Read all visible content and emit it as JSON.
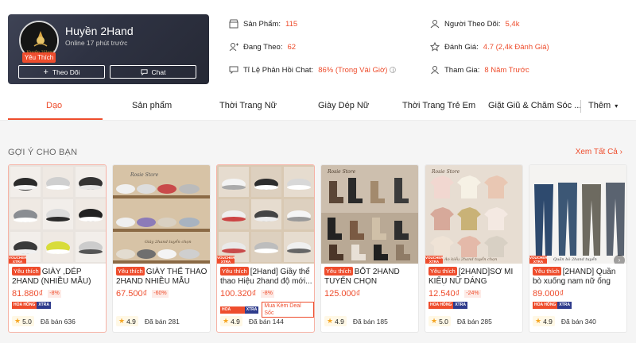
{
  "shop": {
    "name": "Huyền 2Hand",
    "online": "Online 17 phút trước",
    "badge": "Yêu Thích",
    "follow_label": "Theo Dõi",
    "chat_label": "Chat"
  },
  "stats": {
    "products_label": "Sản Phẩm:",
    "products_value": "115",
    "following_label": "Đang Theo:",
    "following_value": "62",
    "response_label": "Tỉ Lệ Phản Hồi Chat:",
    "response_value": "86% (Trong Vài Giờ)",
    "followers_label": "Người Theo Dõi:",
    "followers_value": "5,4k",
    "rating_label": "Đánh Giá:",
    "rating_value": "4.7 (2,4k Đánh Giá)",
    "joined_label": "Tham Gia:",
    "joined_value": "8 Năm Trước"
  },
  "tabs": [
    "Dạo",
    "Sản phẩm",
    "Thời Trang Nữ",
    "Giày Dép Nữ",
    "Thời Trang Trẻ Em",
    "Giặt Giũ & Chăm Sóc ...",
    "Thêm"
  ],
  "section": {
    "title": "GỢI Ý CHO BẠN",
    "see_all": "Xem Tất Cả"
  },
  "labels": {
    "fav": "Yêu thích",
    "voucher": "VOUCHER XTRA",
    "hoahong_a": "HOA HỒNG",
    "hoahong_b": "XTRA",
    "sold_prefix": "Đã bán"
  },
  "products": [
    {
      "title": "GIÀY ,DÉP 2HAND (NHIỀU MẪU)",
      "price": "81.880₫",
      "discount": "-8%",
      "rating": "5.0",
      "sold": "Đã bán 636",
      "extra_tag": ""
    },
    {
      "title": "GIÀY THỂ THAO 2HAND NHIỀU MẪU",
      "price": "67.500₫",
      "discount": "-60%",
      "rating": "4.9",
      "sold": "Đã bán 281",
      "extra_tag": ""
    },
    {
      "title": "[2Hand] Giầy thể thao Hiệu 2hand độ mới...",
      "price": "100.320₫",
      "discount": "-8%",
      "rating": "4.9",
      "sold": "Đã bán 144",
      "extra_tag": "Mua Kèm Deal Sốc"
    },
    {
      "title": "BỐT 2HAND TUYỂN CHỌN",
      "price": "125.000₫",
      "discount": "",
      "rating": "4.9",
      "sold": "Đã bán 185",
      "extra_tag": ""
    },
    {
      "title": "[2HAND]SƠ MI KIỂU NỮ DÁNG NGẮN,...",
      "price": "12.540₫",
      "discount": "-24%",
      "rating": "5.0",
      "sold": "Đã bán 285",
      "extra_tag": ""
    },
    {
      "title": "[2HAND] Quần bò xuống nam nữ ống rộng...",
      "price": "89.000₫",
      "discount": "",
      "rating": "4.9",
      "sold": "Đã bán 340",
      "extra_tag": ""
    }
  ],
  "colors": {
    "accent": "#ee4d2d",
    "shop_card": "#2e3242"
  }
}
